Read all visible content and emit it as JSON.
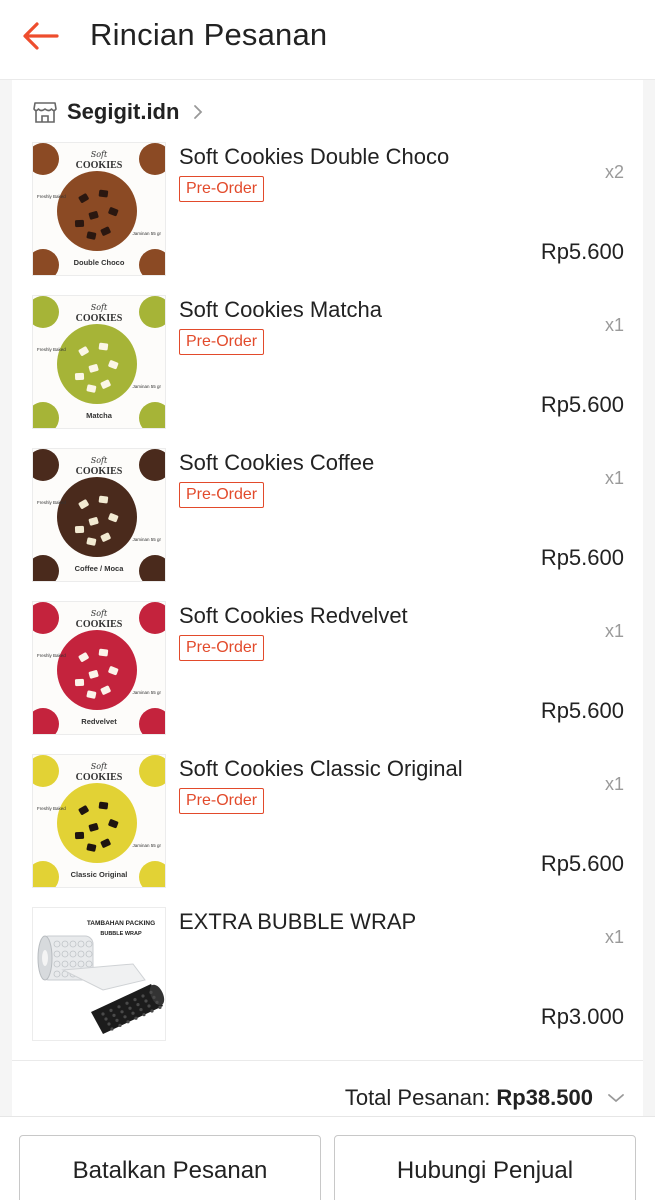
{
  "header": {
    "title": "Rincian Pesanan",
    "back_icon": "arrow-left-icon",
    "accent_color": "#ee4d2d"
  },
  "shop": {
    "name": "Segigit.idn",
    "icon": "store-icon"
  },
  "items": [
    {
      "name": "Soft Cookies Double Choco",
      "badge": "Pre-Order",
      "qty": "x2",
      "price": "Rp5.600",
      "thumb": {
        "brand": "COOKIES",
        "script": "Soft",
        "caption": "Double Choco",
        "side_left": "Freshly Baked",
        "side_right": "Jaminan 55 gr",
        "cookie_color": "#8b4a24",
        "chip_color": "#2a1710",
        "chip_shape": "chunk"
      }
    },
    {
      "name": "Soft Cookies Matcha",
      "badge": "Pre-Order",
      "qty": "x1",
      "price": "Rp5.600",
      "thumb": {
        "brand": "COOKIES",
        "script": "Soft",
        "caption": "Matcha",
        "side_left": "Freshly Baked",
        "side_right": "Jaminan 55 gr",
        "cookie_color": "#a6b437",
        "chip_color": "#fbf6e6",
        "chip_shape": "chunk"
      }
    },
    {
      "name": "Soft Cookies Coffee",
      "badge": "Pre-Order",
      "qty": "x1",
      "price": "Rp5.600",
      "thumb": {
        "brand": "COOKIES",
        "script": "Soft",
        "caption": "Coffee / Moca",
        "side_left": "Freshly Baked",
        "side_right": "Jaminan 55 gr",
        "cookie_color": "#4a2a1c",
        "chip_color": "#f2ead2",
        "chip_shape": "chunk"
      }
    },
    {
      "name": "Soft Cookies Redvelvet",
      "badge": "Pre-Order",
      "qty": "x1",
      "price": "Rp5.600",
      "thumb": {
        "brand": "COOKIES",
        "script": "Soft",
        "caption": "Redvelvet",
        "side_left": "Freshly Baked",
        "side_right": "Jaminan 55 gr",
        "cookie_color": "#c4233d",
        "chip_color": "#fbf4ea",
        "chip_shape": "chunk"
      }
    },
    {
      "name": "Soft Cookies Classic Original",
      "badge": "Pre-Order",
      "qty": "x1",
      "price": "Rp5.600",
      "thumb": {
        "brand": "COOKIES",
        "script": "Soft",
        "caption": "Classic Original",
        "side_left": "Freshly Baked",
        "side_right": "Jaminan 55 gr",
        "cookie_color": "#e2d235",
        "chip_color": "#1e1410",
        "chip_shape": "chunk"
      }
    },
    {
      "name": "EXTRA BUBBLE WRAP",
      "badge": "",
      "qty": "x1",
      "price": "Rp3.000",
      "thumb": {
        "type": "bubble_wrap",
        "line1": "TAMBAHAN PACKING",
        "line2": "BUBBLE WRAP"
      }
    }
  ],
  "summary": {
    "label": "Total Pesanan:",
    "value": "Rp38.500",
    "chevron_icon": "chevron-down-icon"
  },
  "actions": {
    "cancel_label": "Batalkan Pesanan",
    "contact_label": "Hubungi Penjual"
  }
}
